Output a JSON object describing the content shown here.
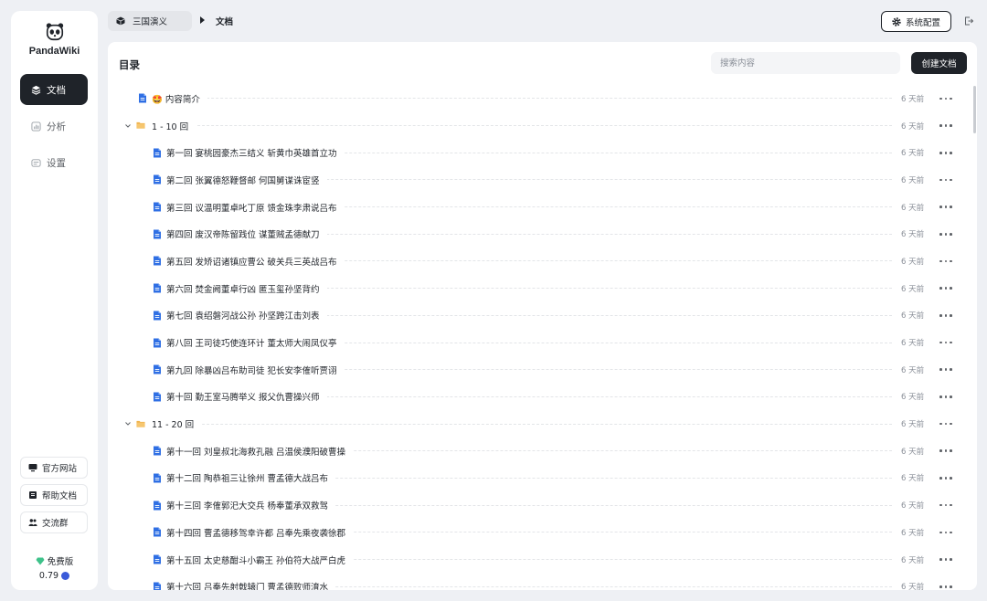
{
  "brand": {
    "name": "PandaWiki"
  },
  "sidebar": {
    "nav": [
      {
        "label": "文档",
        "icon": "layers-icon",
        "active": true
      },
      {
        "label": "分析",
        "icon": "chart-icon",
        "active": false
      },
      {
        "label": "设置",
        "icon": "settings-icon",
        "active": false
      }
    ],
    "links": [
      {
        "label": "官方网站",
        "icon": "monitor-icon"
      },
      {
        "label": "帮助文档",
        "icon": "book-icon"
      },
      {
        "label": "交流群",
        "icon": "group-icon"
      }
    ],
    "edition": {
      "label": "免费版",
      "version": "0.79"
    }
  },
  "topbar": {
    "breadcrumb": "三国演义",
    "current": "文档",
    "system_config": "系统配置"
  },
  "panel": {
    "title": "目录",
    "search_placeholder": "搜索内容",
    "create_button": "创建文档"
  },
  "tree": [
    {
      "type": "doc",
      "level": 0,
      "label": "🤩 内容简介",
      "time": "6 天前"
    },
    {
      "type": "folder",
      "level": 0,
      "label": "1 - 10 回",
      "time": "6 天前"
    },
    {
      "type": "doc",
      "level": 1,
      "label": "第一回 宴桃园豪杰三结义 斩黄巾英雄首立功",
      "time": "6 天前"
    },
    {
      "type": "doc",
      "level": 1,
      "label": "第二回 张翼德怒鞭督邮 何国舅谋诛宦竖",
      "time": "6 天前"
    },
    {
      "type": "doc",
      "level": 1,
      "label": "第三回 议温明董卓叱丁原 馈金珠李肃说吕布",
      "time": "6 天前"
    },
    {
      "type": "doc",
      "level": 1,
      "label": "第四回 废汉帝陈留践位 谋董贼孟德献刀",
      "time": "6 天前"
    },
    {
      "type": "doc",
      "level": 1,
      "label": "第五回 发矫诏诸镇应曹公 破关兵三英战吕布",
      "time": "6 天前"
    },
    {
      "type": "doc",
      "level": 1,
      "label": "第六回 焚金阙董卓行凶 匿玉玺孙坚背约",
      "time": "6 天前"
    },
    {
      "type": "doc",
      "level": 1,
      "label": "第七回 袁绍磐河战公孙 孙坚跨江击刘表",
      "time": "6 天前"
    },
    {
      "type": "doc",
      "level": 1,
      "label": "第八回 王司徒巧使连环计 董太师大闹凤仪亭",
      "time": "6 天前"
    },
    {
      "type": "doc",
      "level": 1,
      "label": "第九回 除暴凶吕布助司徒 犯长安李傕听贾诩",
      "time": "6 天前"
    },
    {
      "type": "doc",
      "level": 1,
      "label": "第十回 勤王室马腾举义 报父仇曹操兴师",
      "time": "6 天前"
    },
    {
      "type": "folder",
      "level": 0,
      "label": "11 - 20 回",
      "time": "6 天前"
    },
    {
      "type": "doc",
      "level": 1,
      "label": "第十一回 刘皇叔北海救孔融 吕温侯濮阳破曹操",
      "time": "6 天前"
    },
    {
      "type": "doc",
      "level": 1,
      "label": "第十二回 陶恭祖三让徐州 曹孟德大战吕布",
      "time": "6 天前"
    },
    {
      "type": "doc",
      "level": 1,
      "label": "第十三回 李傕郭汜大交兵 杨奉董承双救驾",
      "time": "6 天前"
    },
    {
      "type": "doc",
      "level": 1,
      "label": "第十四回 曹孟德移驾幸许都 吕奉先乘夜袭徐郡",
      "time": "6 天前"
    },
    {
      "type": "doc",
      "level": 1,
      "label": "第十五回 太史慈酣斗小霸王 孙伯符大战严白虎",
      "time": "6 天前"
    },
    {
      "type": "doc",
      "level": 1,
      "label": "第十六回 吕奉先射戟辕门 曹孟德败师淯水",
      "time": "6 天前"
    }
  ],
  "colors": {
    "accent": "#1f2329",
    "doc_icon": "#2f6fe4",
    "folder_icon": "#f0b24a",
    "version_badge": "#3a5bd9",
    "edition_icon": "#3ec28a"
  }
}
